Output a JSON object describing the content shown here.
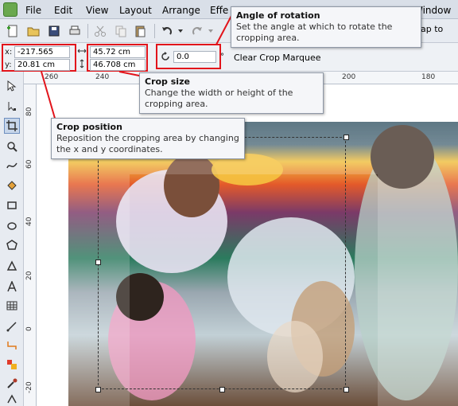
{
  "menubar": {
    "items": [
      "File",
      "Edit",
      "View",
      "Layout",
      "Arrange",
      "Effe",
      "Window"
    ]
  },
  "toolbar": {
    "snap_label": "nap to"
  },
  "propbar": {
    "x_label": "x:",
    "x_value": "-217.565 cm",
    "y_label": "y:",
    "y_value": "20.81 cm",
    "width_value": "45.72 cm",
    "height_value": "46.708 cm",
    "angle_value": "0.0",
    "angle_unit": "°",
    "clear_crop_label": "Clear Crop Marquee"
  },
  "ruler": {
    "top_labels": [
      "260",
      "240",
      "220",
      "200",
      "180"
    ],
    "left_labels": [
      "80",
      "60",
      "40",
      "20",
      "0",
      "-20"
    ]
  },
  "tooltips": {
    "angle": {
      "title": "Angle of rotation",
      "text": "Set the angle at which to rotate the cropping area."
    },
    "size": {
      "title": "Crop size",
      "text": "Change the width or height of the cropping area."
    },
    "position": {
      "title": "Crop position",
      "text": "Reposition the cropping area by changing the x and y coordinates."
    }
  },
  "colors": {
    "highlight_red": "#e2141b",
    "active_tool": "#c7d6ea"
  }
}
